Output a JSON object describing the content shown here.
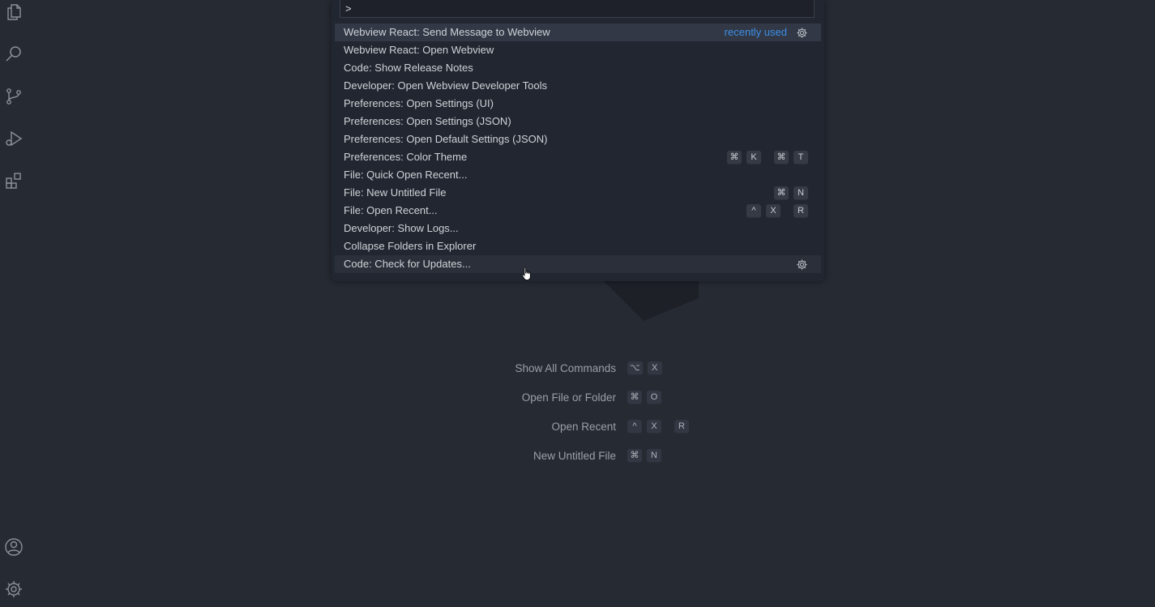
{
  "palette": {
    "input_value": ">",
    "items": [
      {
        "label": "Webview React: Send Message to Webview",
        "badge": "recently used",
        "has_gear": true,
        "keys": []
      },
      {
        "label": "Webview React: Open Webview",
        "keys": []
      },
      {
        "label": "Code: Show Release Notes",
        "keys": []
      },
      {
        "label": "Developer: Open Webview Developer Tools",
        "keys": []
      },
      {
        "label": "Preferences: Open Settings (UI)",
        "keys": []
      },
      {
        "label": "Preferences: Open Settings (JSON)",
        "keys": []
      },
      {
        "label": "Preferences: Open Default Settings (JSON)",
        "keys": []
      },
      {
        "label": "Preferences: Color Theme",
        "keys": [
          "⌘",
          "K",
          "⌘",
          "T"
        ]
      },
      {
        "label": "File: Quick Open Recent...",
        "keys": []
      },
      {
        "label": "File: New Untitled File",
        "keys": [
          "⌘",
          "N"
        ]
      },
      {
        "label": "File: Open Recent...",
        "keys": [
          "^",
          "X",
          "R"
        ]
      },
      {
        "label": "Developer: Show Logs...",
        "keys": []
      },
      {
        "label": "Collapse Folders in Explorer",
        "keys": []
      },
      {
        "label": "Code: Check for Updates...",
        "has_gear": true,
        "keys": []
      }
    ]
  },
  "hints": [
    {
      "label": "Show All Commands",
      "keys": [
        "⌥",
        "X"
      ]
    },
    {
      "label": "Open File or Folder",
      "keys": [
        "⌘",
        "O"
      ]
    },
    {
      "label": "Open Recent",
      "keys": [
        "^",
        "X",
        "R"
      ]
    },
    {
      "label": "New Untitled File",
      "keys": [
        "⌘",
        "N"
      ]
    }
  ],
  "activity_bar": {
    "icons": [
      "explorer-icon",
      "search-icon",
      "source-control-icon",
      "run-debug-icon",
      "extensions-icon",
      "account-icon",
      "settings-gear-icon"
    ]
  },
  "colors": {
    "background": "#262a32",
    "palette_bg": "#222630",
    "accent": "#3d8fe8"
  }
}
